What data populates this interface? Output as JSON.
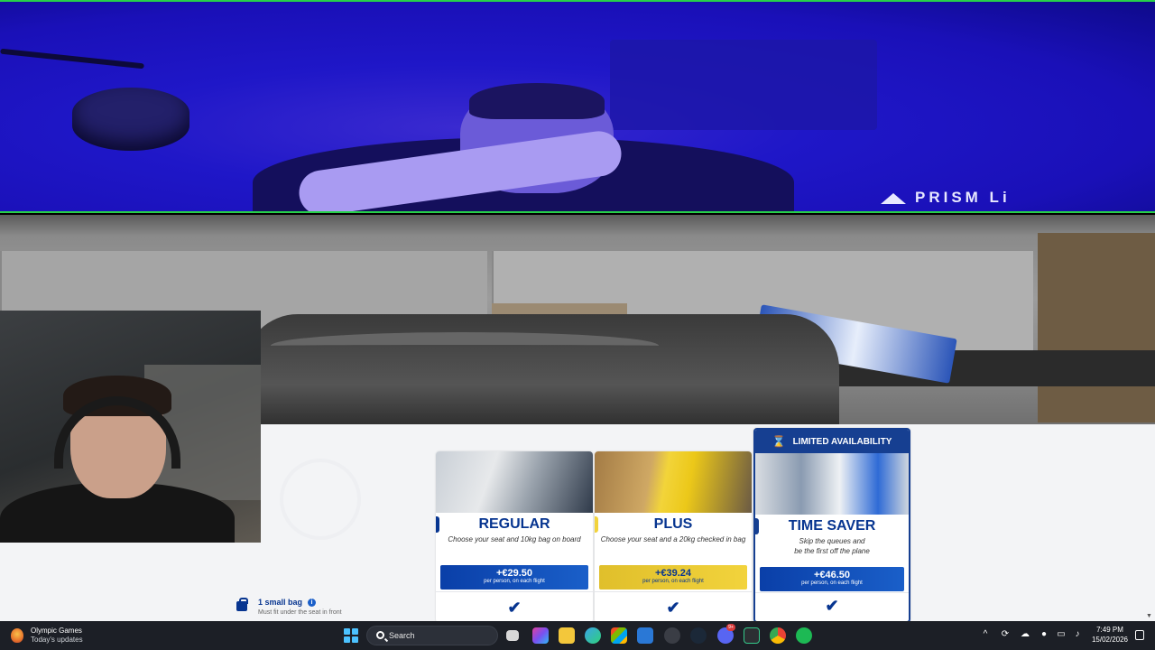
{
  "stream": {
    "overlay_logo": "PRISM Li"
  },
  "fares": [
    {
      "name": "REGULAR",
      "description": "Choose your seat and 10kg bag on board",
      "price": "+€29.50",
      "price_note": "per person, on each flight",
      "accent_color": "#073590",
      "included_check": "✔"
    },
    {
      "name": "PLUS",
      "description": "Choose your seat and a 20kg checked in bag",
      "price": "+€39.24",
      "price_note": "per person, on each flight",
      "accent_color": "#f2d33c",
      "included_check": "✔"
    },
    {
      "banner": "LIMITED AVAILABILITY",
      "banner_icon": "hourglass-icon",
      "name": "TIME SAVER",
      "description_line1": "Skip the queues and",
      "description_line2": "be the first off the plane",
      "price": "+€46.50",
      "price_note": "per person, on each flight",
      "accent_color": "#163f91",
      "included_check": "✔"
    }
  ],
  "bag_row": {
    "title": "1 small bag",
    "subtitle": "Must fit under the seat in front"
  },
  "taskbar": {
    "weather_title": "Olympic Games",
    "weather_sub": "Today's updates",
    "search_placeholder": "Search",
    "discord_badge": "9+",
    "time": "7:49 PM",
    "date": "15/02/2026"
  },
  "colors": {
    "brand_blue": "#073590",
    "brand_yellow": "#f2d33c",
    "taskbar_bg": "#1c1f26"
  }
}
